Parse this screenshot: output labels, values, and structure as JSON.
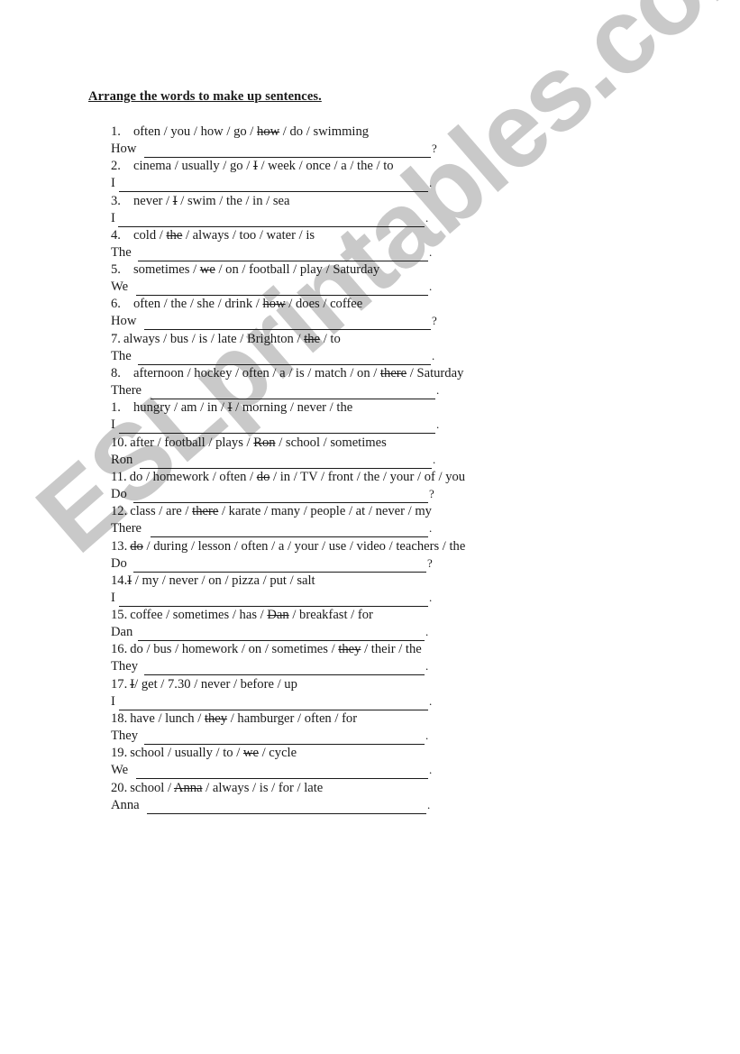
{
  "worksheet": {
    "title": "Arrange the words to make up sentences.",
    "watermark": "ESLprintables.com",
    "items": [
      {
        "number": "1.",
        "style": "tab",
        "words": [
          {
            "t": "often / you / how / go / "
          },
          {
            "t": "how",
            "struck": true
          },
          {
            "t": " / do / swimming"
          }
        ],
        "start": "How",
        "end": "?"
      },
      {
        "number": "2.",
        "style": "tab",
        "words": [
          {
            "t": "cinema / usually / go / "
          },
          {
            "t": "I",
            "struck": true
          },
          {
            "t": " / week / once / a / the / to"
          }
        ],
        "start": "I",
        "end": "."
      },
      {
        "number": "3.",
        "style": "tab",
        "words": [
          {
            "t": "never / "
          },
          {
            "t": "I",
            "struck": true
          },
          {
            "t": " / swim / the / in / sea"
          }
        ],
        "start": "I",
        "end": "."
      },
      {
        "number": "4.",
        "style": "tab",
        "words": [
          {
            "t": "cold / "
          },
          {
            "t": "the",
            "struck": true
          },
          {
            "t": " / always / too / water / is"
          }
        ],
        "start": "The",
        "end": "."
      },
      {
        "number": "5.",
        "style": "tab",
        "words": [
          {
            "t": "sometimes / "
          },
          {
            "t": "we",
            "struck": true
          },
          {
            "t": " / on / football / play / Saturday"
          }
        ],
        "start": "We",
        "end": "."
      },
      {
        "number": "6.",
        "style": "tab",
        "words": [
          {
            "t": "often / the / she / drink / "
          },
          {
            "t": "how",
            "struck": true
          },
          {
            "t": " / does / coffee"
          }
        ],
        "start": "How",
        "end": "?"
      },
      {
        "number": "7.",
        "style": "sp",
        "words": [
          {
            "t": "always / bus / is / late / Brighton / "
          },
          {
            "t": "the",
            "struck": true
          },
          {
            "t": " / to"
          }
        ],
        "start": "The",
        "end": "."
      },
      {
        "number": "8.",
        "style": "tab",
        "words": [
          {
            "t": "afternoon / hockey / often / a / is / match / on / "
          },
          {
            "t": "there",
            "struck": true
          },
          {
            "t": " / Saturday"
          }
        ],
        "start": "There",
        "end": "."
      },
      {
        "number": "1.",
        "style": "tab",
        "words": [
          {
            "t": "hungry / am / in / "
          },
          {
            "t": "I",
            "struck": true
          },
          {
            "t": " / morning / never / the"
          }
        ],
        "start": "I",
        "end": "."
      },
      {
        "number": "10.",
        "style": "sp",
        "words": [
          {
            "t": "after / football / plays / "
          },
          {
            "t": "Ron",
            "struck": true
          },
          {
            "t": " / school / sometimes"
          }
        ],
        "start": "Ron",
        "end": "."
      },
      {
        "number": "11.",
        "style": "sp",
        "words": [
          {
            "t": "do / homework / often / "
          },
          {
            "t": "do",
            "struck": true
          },
          {
            "t": " / in / TV / front / the / your / of / you"
          }
        ],
        "start": "Do",
        "end": "?"
      },
      {
        "number": "12.",
        "style": "sp",
        "words": [
          {
            "t": "class / are / "
          },
          {
            "t": "there",
            "struck": true
          },
          {
            "t": " / karate / many / people / at / never / my"
          }
        ],
        "start": "There",
        "end": "."
      },
      {
        "number": "13.",
        "style": "sp",
        "words": [
          {
            "t": "do",
            "struck": true
          },
          {
            "t": " / during / lesson / often / a / your / use / video / teachers / the"
          }
        ],
        "start": "Do",
        "end": "?"
      },
      {
        "number": "14.",
        "style": "none",
        "words": [
          {
            "t": "I",
            "struck": true
          },
          {
            "t": " / my / never / on / pizza / put / salt"
          }
        ],
        "start": "I",
        "end": "."
      },
      {
        "number": "15.",
        "style": "sp",
        "words": [
          {
            "t": "coffee / sometimes / has / "
          },
          {
            "t": "Dan",
            "struck": true
          },
          {
            "t": " / breakfast / for"
          }
        ],
        "start": "Dan",
        "end": "."
      },
      {
        "number": "16.",
        "style": "sp",
        "words": [
          {
            "t": "do / bus / homework / on / sometimes / "
          },
          {
            "t": "they",
            "struck": true
          },
          {
            "t": " / their / the"
          }
        ],
        "start": "They",
        "end": "."
      },
      {
        "number": "17.",
        "style": "sp",
        "words": [
          {
            "t": "I",
            "struck": true
          },
          {
            "t": "/ get / 7.30 / never / before / up"
          }
        ],
        "start": "I",
        "end": "."
      },
      {
        "number": "18.",
        "style": "sp",
        "words": [
          {
            "t": "have / lunch / "
          },
          {
            "t": "they",
            "struck": true
          },
          {
            "t": " / hamburger / often / for"
          }
        ],
        "start": "They",
        "end": "."
      },
      {
        "number": "19.",
        "style": "sp",
        "words": [
          {
            "t": "school / usually / to / "
          },
          {
            "t": "we",
            "struck": true
          },
          {
            "t": " / cycle"
          }
        ],
        "start": "We",
        "end": "."
      },
      {
        "number": "20.",
        "style": "sp",
        "words": [
          {
            "t": "school / "
          },
          {
            "t": "Anna",
            "struck": true
          },
          {
            "t": " / always / is / for / late"
          }
        ],
        "start": "Anna",
        "end": "."
      }
    ]
  }
}
